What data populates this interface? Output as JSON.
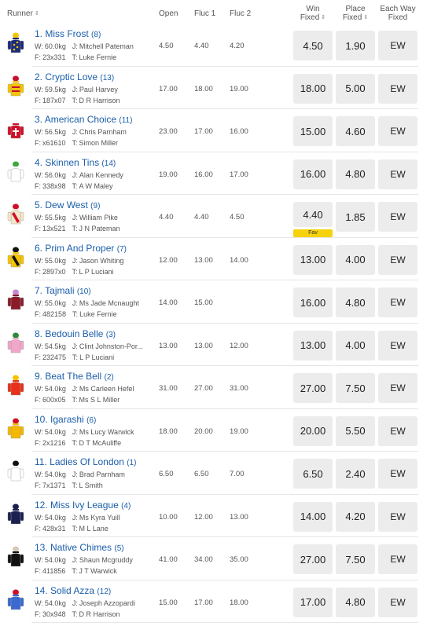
{
  "header": {
    "runner": "Runner",
    "open": "Open",
    "fluc1": "Fluc 1",
    "fluc2": "Fluc 2",
    "win_fixed_1": "Win",
    "win_fixed_2": "Fixed",
    "place_fixed_1": "Place",
    "place_fixed_2": "Fixed",
    "ew_fixed_1": "Each Way",
    "ew_fixed_2": "Fixed",
    "sort_icon": "sort-arrows-icon"
  },
  "labels": {
    "w": "W:",
    "j": "J:",
    "f": "F:",
    "t": "T:"
  },
  "runners": [
    {
      "num": "1.",
      "name": "Miss Frost",
      "barrier": "(8)",
      "weight": "60.0kg",
      "jockey": "Mitchell Pateman",
      "form": "23x331",
      "trainer": "Luke Fernie",
      "open": "4.50",
      "fluc1": "4.40",
      "fluc2": "4.20",
      "win": "4.50",
      "place": "1.90",
      "ew": "EW",
      "silk": {
        "body": "#1a2a7a",
        "accent": "#f2c400",
        "pattern": "stars"
      }
    },
    {
      "num": "2.",
      "name": "Cryptic Love",
      "barrier": "(13)",
      "weight": "59.5kg",
      "jockey": "Paul Harvey",
      "form": "187x07",
      "trainer": "D R Harrison",
      "open": "17.00",
      "fluc1": "18.00",
      "fluc2": "19.00",
      "win": "18.00",
      "place": "5.00",
      "ew": "EW",
      "silk": {
        "body": "#f5c400",
        "accent": "#c8102e",
        "pattern": "hoops"
      }
    },
    {
      "num": "3.",
      "name": "American Choice",
      "barrier": "(11)",
      "weight": "56.5kg",
      "jockey": "Chris Parnham",
      "form": "x61610",
      "trainer": "Simon Miller",
      "open": "23.00",
      "fluc1": "17.00",
      "fluc2": "16.00",
      "win": "15.00",
      "place": "4.60",
      "ew": "EW",
      "silk": {
        "body": "#d0102a",
        "accent": "#ffffff",
        "pattern": "cross"
      }
    },
    {
      "num": "4.",
      "name": "Skinnen Tins",
      "barrier": "(14)",
      "weight": "56.0kg",
      "jockey": "Alan Kennedy",
      "form": "338x98",
      "trainer": "A W Maley",
      "open": "19.00",
      "fluc1": "16.00",
      "fluc2": "17.00",
      "win": "16.00",
      "place": "4.80",
      "ew": "EW",
      "silk": {
        "body": "#ffffff",
        "accent": "#3aa83a",
        "pattern": "plain"
      }
    },
    {
      "num": "5.",
      "name": "Dew West",
      "barrier": "(9)",
      "weight": "55.5kg",
      "jockey": "William Pike",
      "form": "13x521",
      "trainer": "J N Pateman",
      "open": "4.40",
      "fluc1": "4.40",
      "fluc2": "4.50",
      "win": "4.40",
      "place": "1.85",
      "ew": "EW",
      "fav": "Fav",
      "silk": {
        "body": "#f5e6c8",
        "accent": "#d0102a",
        "pattern": "sash"
      }
    },
    {
      "num": "6.",
      "name": "Prim And Proper",
      "barrier": "(7)",
      "weight": "55.0kg",
      "jockey": "Jason Whiting",
      "form": "2897x0",
      "trainer": "L P Luciani",
      "open": "12.00",
      "fluc1": "13.00",
      "fluc2": "14.00",
      "win": "13.00",
      "place": "4.00",
      "ew": "EW",
      "silk": {
        "body": "#f5c400",
        "accent": "#111111",
        "pattern": "sash"
      }
    },
    {
      "num": "7.",
      "name": "Tajmali",
      "barrier": "(10)",
      "weight": "55.0kg",
      "jockey": "Ms Jade Mcnaught",
      "form": "482158",
      "trainer": "Luke Fernie",
      "open": "14.00",
      "fluc1": "15.00",
      "fluc2": "",
      "win": "16.00",
      "place": "4.80",
      "ew": "EW",
      "silk": {
        "body": "#8a1c2a",
        "accent": "#c48ad0",
        "pattern": "plain"
      }
    },
    {
      "num": "8.",
      "name": "Bedouin Belle",
      "barrier": "(3)",
      "weight": "54.5kg",
      "jockey": "Clint Johnston-Por...",
      "form": "232475",
      "trainer": "L P Luciani",
      "open": "13.00",
      "fluc1": "13.00",
      "fluc2": "12.00",
      "win": "13.00",
      "place": "4.00",
      "ew": "EW",
      "silk": {
        "body": "#f2a6c8",
        "accent": "#2a8a3a",
        "pattern": "plain"
      }
    },
    {
      "num": "9.",
      "name": "Beat The Bell",
      "barrier": "(2)",
      "weight": "54.0kg",
      "jockey": "Ms Carleen Hefel",
      "form": "600x05",
      "trainer": "Ms S L Miller",
      "open": "31.00",
      "fluc1": "27.00",
      "fluc2": "31.00",
      "win": "27.00",
      "place": "7.50",
      "ew": "EW",
      "silk": {
        "body": "#e8301a",
        "accent": "#f5c400",
        "pattern": "plain"
      }
    },
    {
      "num": "10.",
      "name": "Igarashi",
      "barrier": "(6)",
      "weight": "54.0kg",
      "jockey": "Ms Lucy Warwick",
      "form": "2x1216",
      "trainer": "D T McAuliffe",
      "open": "18.00",
      "fluc1": "20.00",
      "fluc2": "19.00",
      "win": "20.00",
      "place": "5.50",
      "ew": "EW",
      "silk": {
        "body": "#f5b800",
        "accent": "#d0102a",
        "pattern": "plain"
      }
    },
    {
      "num": "11.",
      "name": "Ladies Of London",
      "barrier": "(1)",
      "weight": "54.0kg",
      "jockey": "Brad Parnham",
      "form": "7x1371",
      "trainer": "L Smith",
      "open": "6.50",
      "fluc1": "6.50",
      "fluc2": "7.00",
      "win": "6.50",
      "place": "2.40",
      "ew": "EW",
      "silk": {
        "body": "#ffffff",
        "accent": "#111111",
        "pattern": "plain"
      }
    },
    {
      "num": "12.",
      "name": "Miss Ivy League",
      "barrier": "(4)",
      "weight": "54.0kg",
      "jockey": "Ms Kyra Yuill",
      "form": "428x31",
      "trainer": "M L Lane",
      "open": "10.00",
      "fluc1": "12.00",
      "fluc2": "13.00",
      "win": "14.00",
      "place": "4.20",
      "ew": "EW",
      "silk": {
        "body": "#1a2050",
        "accent": "#1a2050",
        "pattern": "plain"
      }
    },
    {
      "num": "13.",
      "name": "Native Chimes",
      "barrier": "(5)",
      "weight": "54.0kg",
      "jockey": "Shaun Mcgruddy",
      "form": "411856",
      "trainer": "J T Warwick",
      "open": "41.00",
      "fluc1": "34.00",
      "fluc2": "35.00",
      "win": "27.00",
      "place": "7.50",
      "ew": "EW",
      "silk": {
        "body": "#111111",
        "accent": "#d8c8b8",
        "pattern": "plain"
      }
    },
    {
      "num": "14.",
      "name": "Solid Azza",
      "barrier": "(12)",
      "weight": "54.0kg",
      "jockey": "Joseph Azzopardi",
      "form": "30x948",
      "trainer": "D R Harrison",
      "open": "15.00",
      "fluc1": "17.00",
      "fluc2": "18.00",
      "win": "17.00",
      "place": "4.80",
      "ew": "EW",
      "silk": {
        "body": "#3a6ad0",
        "accent": "#d0102a",
        "pattern": "plain"
      }
    }
  ]
}
